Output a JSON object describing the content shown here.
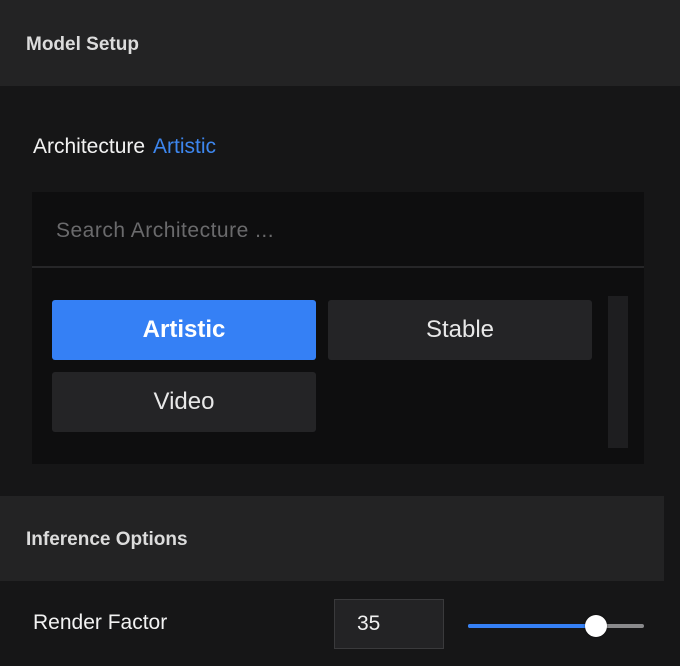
{
  "model_setup": {
    "title": "Model Setup",
    "architecture_label": "Architecture",
    "architecture_value": "Artistic",
    "search_placeholder": "Search Architecture ...",
    "options": [
      {
        "label": "Artistic",
        "selected": true
      },
      {
        "label": "Stable",
        "selected": false
      },
      {
        "label": "Video",
        "selected": false
      }
    ]
  },
  "inference_options": {
    "title": "Inference Options",
    "render_factor": {
      "label": "Render Factor",
      "value": "35",
      "slider_fraction": 0.73
    }
  },
  "colors": {
    "accent": "#3580f5",
    "link": "#3d86ee",
    "background": "#161617",
    "header": "#232324"
  }
}
